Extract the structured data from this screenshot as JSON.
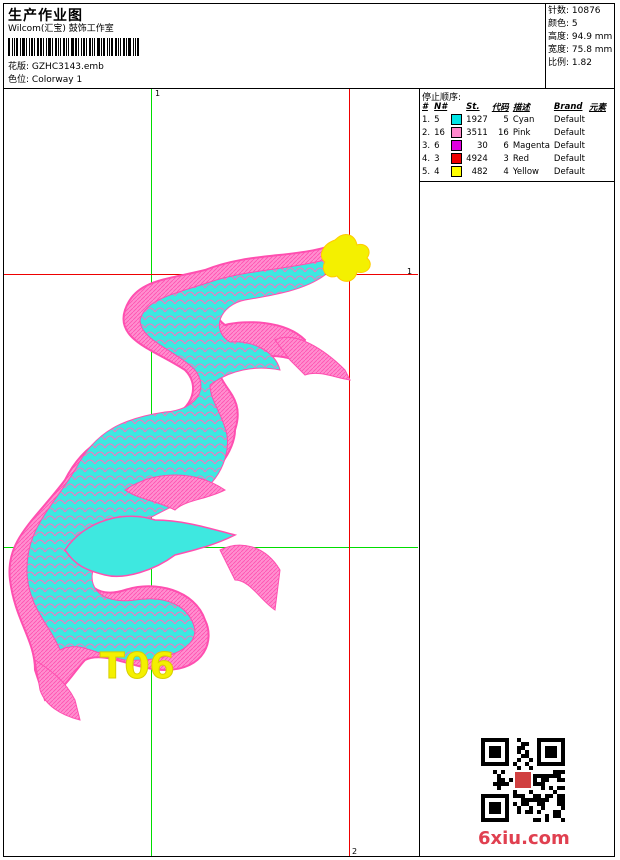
{
  "header": {
    "title": "生产作业图",
    "company": "Wilcom(汇宝) 鼓饰工作室",
    "design_label": "花版:",
    "design_value": "GZHC3143.emb",
    "colorway_label": "色位:",
    "colorway_value": "Colorway 1"
  },
  "stats": {
    "stitches": "针数: 10876",
    "colors": "颜色: 5",
    "height": "高度: 94.9 mm",
    "width": "宽度: 75.8 mm",
    "scale": "比例: 1.82"
  },
  "stop_sequence": {
    "title": "停止顺序:",
    "headers": [
      "#",
      "N#",
      "St.",
      "代码",
      "描述",
      "Brand",
      "元素"
    ],
    "rows": [
      {
        "idx": "1.",
        "n": "5",
        "color": "#00e5e5",
        "st": "1927",
        "code": "5",
        "desc": "Cyan",
        "brand": "Default"
      },
      {
        "idx": "2.",
        "n": "16",
        "color": "#ff88cc",
        "st": "3511",
        "code": "16",
        "desc": "Pink",
        "brand": "Default"
      },
      {
        "idx": "3.",
        "n": "6",
        "color": "#e000e0",
        "st": "30",
        "code": "6",
        "desc": "Magenta",
        "brand": "Default"
      },
      {
        "idx": "4.",
        "n": "3",
        "color": "#ee0000",
        "st": "4924",
        "code": "3",
        "desc": "Red",
        "brand": "Default"
      },
      {
        "idx": "5.",
        "n": "4",
        "color": "#ffff00",
        "st": "482",
        "code": "4",
        "desc": "Yellow",
        "brand": "Default"
      }
    ]
  },
  "guides": {
    "label_1": "1",
    "label_2": "2",
    "label_r": "1"
  },
  "artwork": {
    "text": "T06",
    "colors": {
      "pink": "#ff6fbf",
      "cyan": "#3ee8e0",
      "yellow": "#f4f000",
      "magenta": "#e000e0"
    }
  },
  "watermark": {
    "logo_text": "6xiu.com"
  }
}
